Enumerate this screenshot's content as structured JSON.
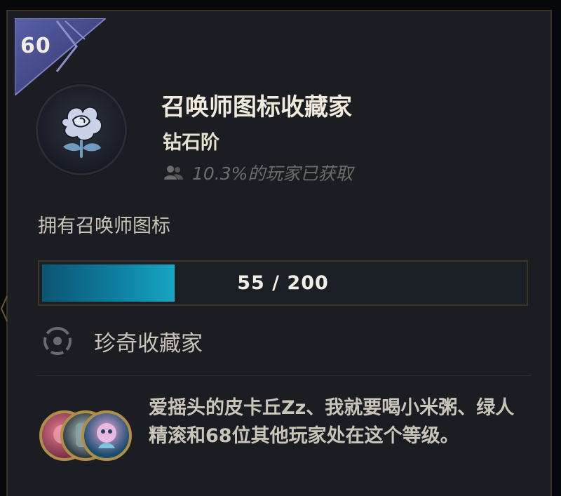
{
  "level": "60",
  "title": "召唤师图标收藏家",
  "tier": "钻石阶",
  "rarity_text": "10.3%的玩家已获取",
  "description": "拥有召唤师图标",
  "progress": {
    "current": 55,
    "total": 200,
    "fraction": 0.275,
    "label": "55 / 200"
  },
  "next_tier_label": "珍奇收藏家",
  "players_text": "爱摇头的皮卡丘Zz、我就要喝小米粥、绿人精滚和68位其他玩家处在这个等级。",
  "icons": {
    "badge": "level-badge-icon",
    "challenge": "rose-icon",
    "rarity": "players-icon",
    "next_tier": "target-icon",
    "avatars": [
      "player-avatar-1",
      "player-avatar-2",
      "player-avatar-3"
    ]
  },
  "colors": {
    "background": "#1c1d22",
    "border_gold": "#3a3324",
    "badge": "#4a4d8f",
    "progress_fill": "#0e7da0",
    "text_primary": "#f0ebdc",
    "text_muted": "#6c6c6c"
  }
}
